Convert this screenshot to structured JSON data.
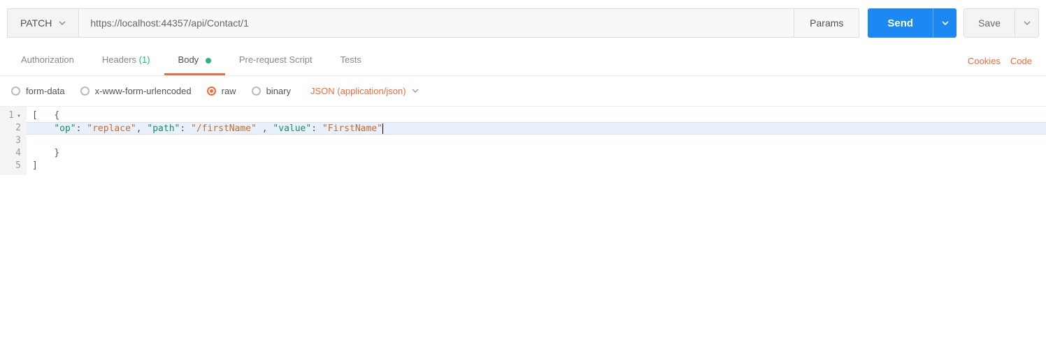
{
  "request": {
    "method": "PATCH",
    "url": "https://localhost:44357/api/Contact/1",
    "params_label": "Params",
    "send_label": "Send",
    "save_label": "Save"
  },
  "tabs": {
    "authorization": "Authorization",
    "headers": "Headers",
    "headers_count": "(1)",
    "body": "Body",
    "prerequest": "Pre-request Script",
    "tests": "Tests"
  },
  "actions": {
    "cookies": "Cookies",
    "code": "Code"
  },
  "body_types": {
    "formdata": "form-data",
    "xwww": "x-www-form-urlencoded",
    "raw": "raw",
    "binary": "binary",
    "content_type": "JSON (application/json)"
  },
  "editor": {
    "gutter": [
      "1",
      "2",
      "3",
      "4",
      "5"
    ],
    "line1_bracket": "[",
    "line1_brace": "{",
    "line2": {
      "k_op": "\"op\"",
      "v_op": "\"replace\"",
      "k_path": "\"path\"",
      "v_path": "\"/firstName\"",
      "k_value": "\"value\"",
      "v_value": "\"FirstName\""
    },
    "line4_brace": "}",
    "line5_bracket": "]"
  }
}
